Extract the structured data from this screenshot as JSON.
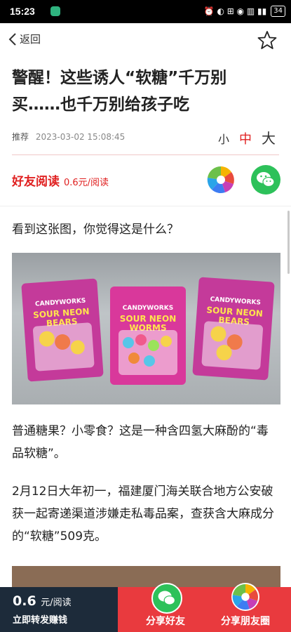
{
  "status_bar": {
    "time": "15:23",
    "battery": "34",
    "icons": "⏰ ◐ ⊞ ◉ ▥ ▮▮"
  },
  "nav": {
    "back_label": "返回"
  },
  "article": {
    "title": "警醒！这些诱人“软糖”千万别买……也千万别给孩子吃",
    "tag": "推荐",
    "datetime": "2023-03-02 15:08:45",
    "font_small": "小",
    "font_medium": "中",
    "font_large": "大",
    "paragraph1": "看到这张图，你觉得这是什么？",
    "paragraph2": "普通糖果？小零食？这是一种含四氢大麻酚的“毒品软糖”。",
    "paragraph3": "2月12日大年初一，福建厦门海关联合地方公安破获一起寄递渠道涉嫌走私毒品案，查获含大麻成分的“软糖”509克。"
  },
  "read_bar": {
    "label": "好友阅读",
    "price": "0.6元/阅读"
  },
  "photo": {
    "bags": [
      {
        "brand": "CANDYWORKS",
        "name": "SOUR NEON BEARS"
      },
      {
        "brand": "CANDYWORKS",
        "name": "SOUR NEON WORMS"
      },
      {
        "brand": "CANDYWORKS",
        "name": "SOUR NEON BEARS"
      }
    ]
  },
  "bottom_bar": {
    "price_value": "0.6",
    "price_unit": "元/阅读",
    "subtitle": "立即转发赚钱",
    "share_friend": "分享好友",
    "share_moments": "分享朋友圈"
  },
  "colors": {
    "accent_red": "#e02020",
    "wechat_green": "#2dc15a",
    "bar_dark": "#1d2b3a",
    "bar_red": "#e93a3e"
  }
}
